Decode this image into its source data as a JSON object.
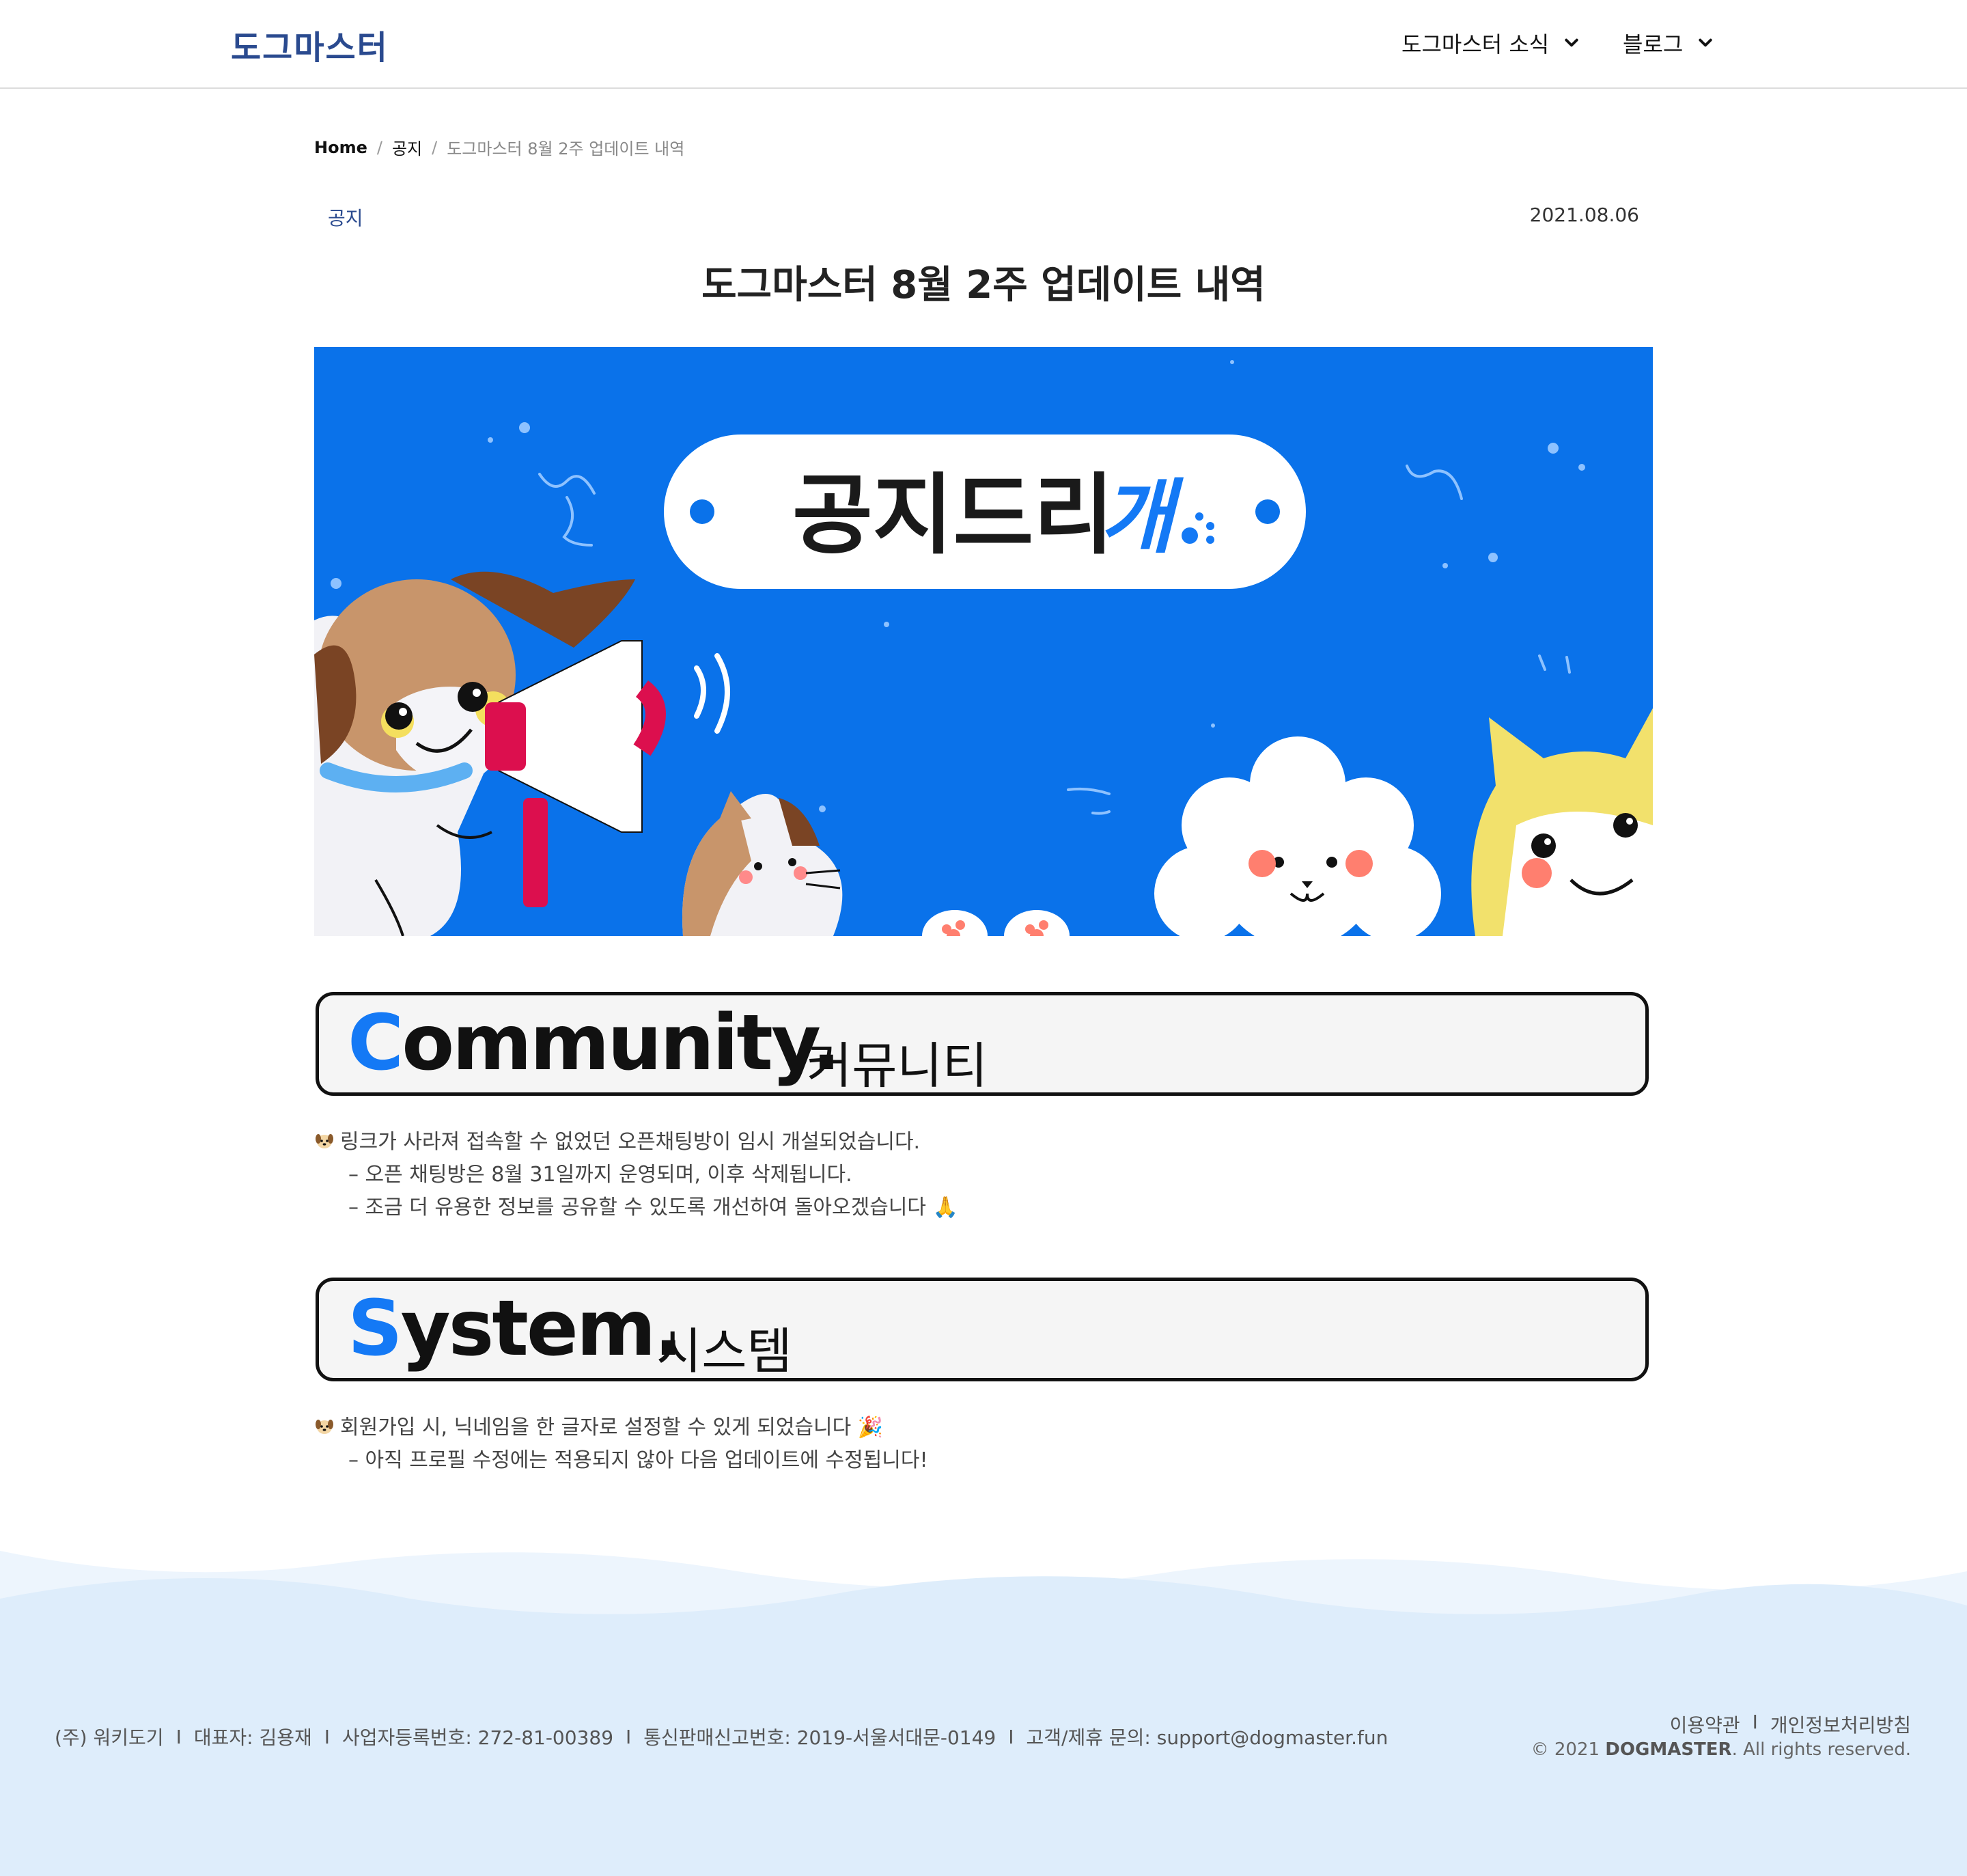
{
  "header": {
    "logo": "도그마스터",
    "nav": [
      {
        "label": "도그마스터 소식",
        "icon": "chevron-down-icon"
      },
      {
        "label": "블로그",
        "icon": "chevron-down-icon"
      }
    ]
  },
  "breadcrumb": {
    "home": "Home",
    "separator": "/",
    "category": "공지",
    "current": "도그마스터 8월 2주 업데이트 내역"
  },
  "post": {
    "category": "공지",
    "date": "2021.08.06",
    "title": "도그마스터 8월 2주 업데이트 내역",
    "banner": {
      "text_main": "공지드리",
      "text_accent": "개",
      "bg_color": "#0a72ea",
      "accent_color": "#1479f5"
    }
  },
  "sections": [
    {
      "heading_first": "C",
      "heading_rest": "ommunity.",
      "heading_ko": "커뮤니티",
      "lines": [
        "링크가 사라져 접속할 수 없었던 오픈채팅방이 임시 개설되었습니다.",
        "– 오픈 채팅방은 8월 31일까지 운영되며, 이후 삭제됩니다.",
        "– 조금 더 유용한 정보를 공유할 수 있도록 개선하여 돌아오겠습니다 🙏"
      ]
    },
    {
      "heading_first": "S",
      "heading_rest": "ystem.",
      "heading_ko": "시스템",
      "lines": [
        "회원가입 시, 닉네임을 한 글자로 설정할 수 있게 되었습니다 🎉",
        "– 아직 프로필 수정에는 적용되지 않아 다음 업데이트에 수정됩니다!"
      ]
    }
  ],
  "footer": {
    "company": "(주) 워키도기",
    "ceo": "대표자: 김용재",
    "biz_no": "사업자등록번호: 272-81-00389",
    "mail_order_no": "통신판매신고번호: 2019-서울서대문-0149",
    "contact": "고객/제휴 문의: support@dogmaster.fun",
    "separator": "I",
    "terms": "이용약관",
    "privacy": "개인정보처리방침",
    "copyright_prefix": "© 2021",
    "copyright_brand": "DOGMASTER",
    "copyright_suffix": ". All rights reserved.",
    "bg_color": "#deedfb"
  }
}
